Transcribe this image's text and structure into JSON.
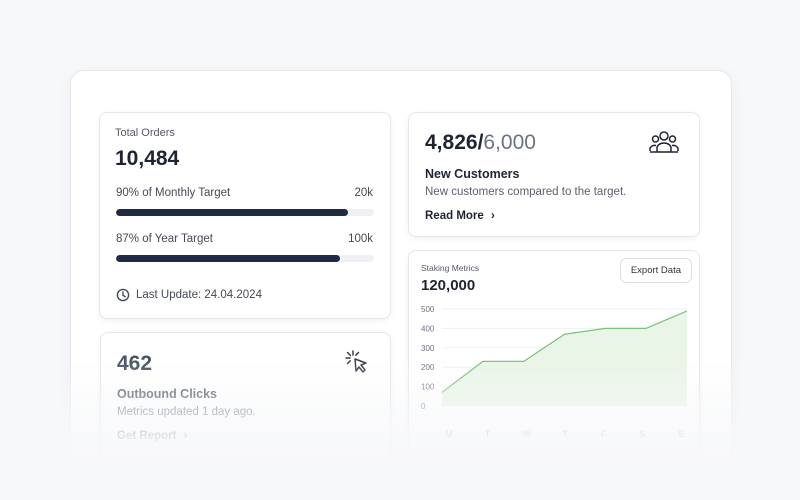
{
  "orders": {
    "label": "Total Orders",
    "value": "10,484",
    "monthly": {
      "label": "90% of Monthly Target",
      "target": "20k",
      "progress": 0.9
    },
    "yearly": {
      "label": "87% of Year Target",
      "target": "100k",
      "progress": 0.87
    },
    "last_update": "Last Update: 24.04.2024",
    "icon": "clock-icon"
  },
  "customers": {
    "current": "4,826",
    "separator": "/",
    "target": "6,000",
    "title": "New Customers",
    "subtitle": "New customers compared to the target.",
    "link": "Read More",
    "icon": "users-icon"
  },
  "outbound": {
    "value": "462",
    "title": "Outbound Clicks",
    "subtitle": "Metrics updated 1 day ago.",
    "link": "Get Report",
    "icon": "cursor-click-icon"
  },
  "staking": {
    "label": "Staking Metrics",
    "value": "120,000",
    "export_label": "Export Data"
  },
  "chart_data": {
    "type": "area",
    "categories": [
      "M",
      "T",
      "W",
      "T",
      "F",
      "S",
      "S"
    ],
    "values": [
      70,
      230,
      230,
      370,
      400,
      400,
      490
    ],
    "yticks": [
      0,
      100,
      200,
      300,
      400,
      500
    ],
    "ylim": [
      0,
      500
    ],
    "grid": true,
    "colors": {
      "line": "#7cc27c",
      "fill": "#e9f5e6"
    }
  }
}
